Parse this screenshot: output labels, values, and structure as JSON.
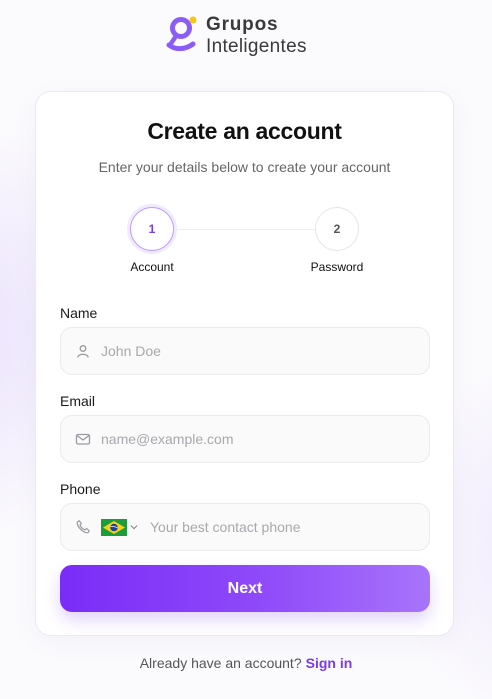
{
  "brand": {
    "line1": "Grupos",
    "line2": "Inteligentes",
    "accent": "#7c3aed"
  },
  "card": {
    "title": "Create an account",
    "subtitle": "Enter your details below to create your account"
  },
  "stepper": {
    "steps": [
      {
        "number": "1",
        "label": "Account",
        "active": true
      },
      {
        "number": "2",
        "label": "Password",
        "active": false
      }
    ]
  },
  "form": {
    "name": {
      "label": "Name",
      "placeholder": "John Doe",
      "icon": "user-icon",
      "value": ""
    },
    "email": {
      "label": "Email",
      "placeholder": "name@example.com",
      "icon": "mail-icon",
      "value": ""
    },
    "phone": {
      "label": "Phone",
      "placeholder": "Your best contact phone",
      "icon": "phone-icon",
      "country": "Brazil",
      "value": ""
    }
  },
  "actions": {
    "next_label": "Next"
  },
  "footer": {
    "prompt": "Already have an account?",
    "link_label": "Sign in"
  }
}
